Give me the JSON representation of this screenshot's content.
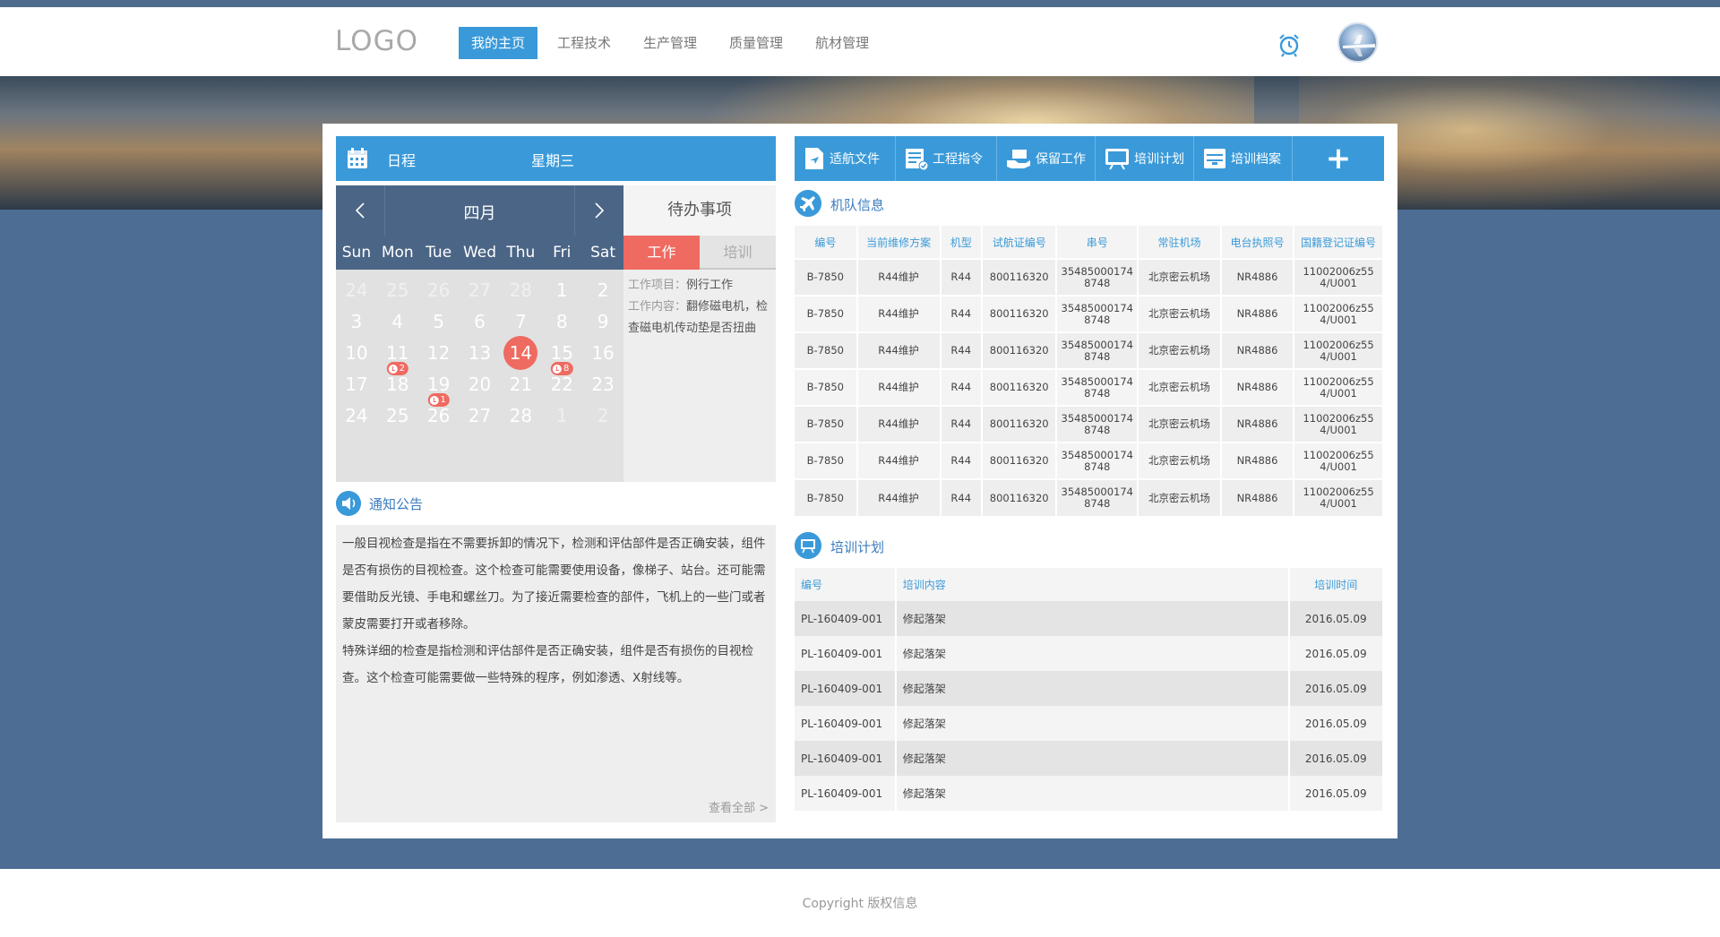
{
  "header": {
    "logo": "LOGO",
    "nav": [
      "我的主页",
      "工程技术",
      "生产管理",
      "质量管理",
      "航材管理"
    ],
    "active_nav": "我的主页"
  },
  "schedule": {
    "label": "日程",
    "weekday": "星期三",
    "month": "四月",
    "week_days": [
      "Sun",
      "Mon",
      "Tue",
      "Wed",
      "Thu",
      "Fri",
      "Sat"
    ],
    "weeks": [
      [
        "24",
        "25",
        "26",
        "27",
        "28",
        "1",
        "2"
      ],
      [
        "3",
        "4",
        "5",
        "6",
        "7",
        "8",
        "9"
      ],
      [
        "10",
        "11",
        "12",
        "13",
        "14",
        "15",
        "16"
      ],
      [
        "17",
        "18",
        "19",
        "20",
        "21",
        "22",
        "23"
      ],
      [
        "24",
        "25",
        "26",
        "27",
        "28",
        "1",
        "2"
      ]
    ],
    "today": "14",
    "badges": {
      "11": "2",
      "15": "8",
      "19": "1"
    }
  },
  "todo": {
    "title": "待办事项",
    "tabs": [
      "工作",
      "培训"
    ],
    "item_label": "工作项目：",
    "item_value": "例行工作",
    "content_label": "工作内容：",
    "content_value": "翻修磁电机，检查磁电机传动垫是否扭曲"
  },
  "notice": {
    "title": "通知公告",
    "paragraphs": [
      "一般目视检查是指在不需要拆卸的情况下，检测和评估部件是否正确安装，组件是否有损伤的目视检查。这个检查可能需要使用设备，像梯子、站台。还可能需要借助反光镜、手电和螺丝刀。为了接近需要检查的部件，飞机上的一些门或者蒙皮需要打开或者移除。",
      "特殊详细的检查是指检测和评估部件是否正确安装，组件是否有损伤的目视检查。这个检查可能需要做一些特殊的程序，例如渗透、X射线等。"
    ],
    "more": "查看全部 >"
  },
  "toolbar": {
    "items": [
      "适航文件",
      "工程指令",
      "保留工作",
      "培训计划",
      "培训档案"
    ],
    "plus": "+"
  },
  "fleet": {
    "title": "机队信息",
    "columns": [
      "编号",
      "当前维修方案",
      "机型",
      "试航证编号",
      "串号",
      "常驻机场",
      "电台执照号",
      "国籍登记证编号"
    ],
    "rows": [
      [
        "B-7850",
        "R44维护",
        "R44",
        "800116320",
        "354850001748748",
        "北京密云机场",
        "NR4886",
        "11002006z554/U001"
      ],
      [
        "B-7850",
        "R44维护",
        "R44",
        "800116320",
        "354850001748748",
        "北京密云机场",
        "NR4886",
        "11002006z554/U001"
      ],
      [
        "B-7850",
        "R44维护",
        "R44",
        "800116320",
        "354850001748748",
        "北京密云机场",
        "NR4886",
        "11002006z554/U001"
      ],
      [
        "B-7850",
        "R44维护",
        "R44",
        "800116320",
        "354850001748748",
        "北京密云机场",
        "NR4886",
        "11002006z554/U001"
      ],
      [
        "B-7850",
        "R44维护",
        "R44",
        "800116320",
        "354850001748748",
        "北京密云机场",
        "NR4886",
        "11002006z554/U001"
      ],
      [
        "B-7850",
        "R44维护",
        "R44",
        "800116320",
        "354850001748748",
        "北京密云机场",
        "NR4886",
        "11002006z554/U001"
      ],
      [
        "B-7850",
        "R44维护",
        "R44",
        "800116320",
        "354850001748748",
        "北京密云机场",
        "NR4886",
        "11002006z554/U001"
      ]
    ]
  },
  "training": {
    "title": "培训计划",
    "columns": [
      "编号",
      "培训内容",
      "培训时间"
    ],
    "rows": [
      [
        "PL-160409-001",
        "修起落架",
        "2016.05.09"
      ],
      [
        "PL-160409-001",
        "修起落架",
        "2016.05.09"
      ],
      [
        "PL-160409-001",
        "修起落架",
        "2016.05.09"
      ],
      [
        "PL-160409-001",
        "修起落架",
        "2016.05.09"
      ],
      [
        "PL-160409-001",
        "修起落架",
        "2016.05.09"
      ],
      [
        "PL-160409-001",
        "修起落架",
        "2016.05.09"
      ]
    ]
  },
  "footer": {
    "copyright": "Copyright 版权信息"
  },
  "colors": {
    "primary": "#3a9ad9",
    "accent": "#ef6a60",
    "calendar_nav": "#4b6586",
    "page_bg": "#4d6d94"
  }
}
